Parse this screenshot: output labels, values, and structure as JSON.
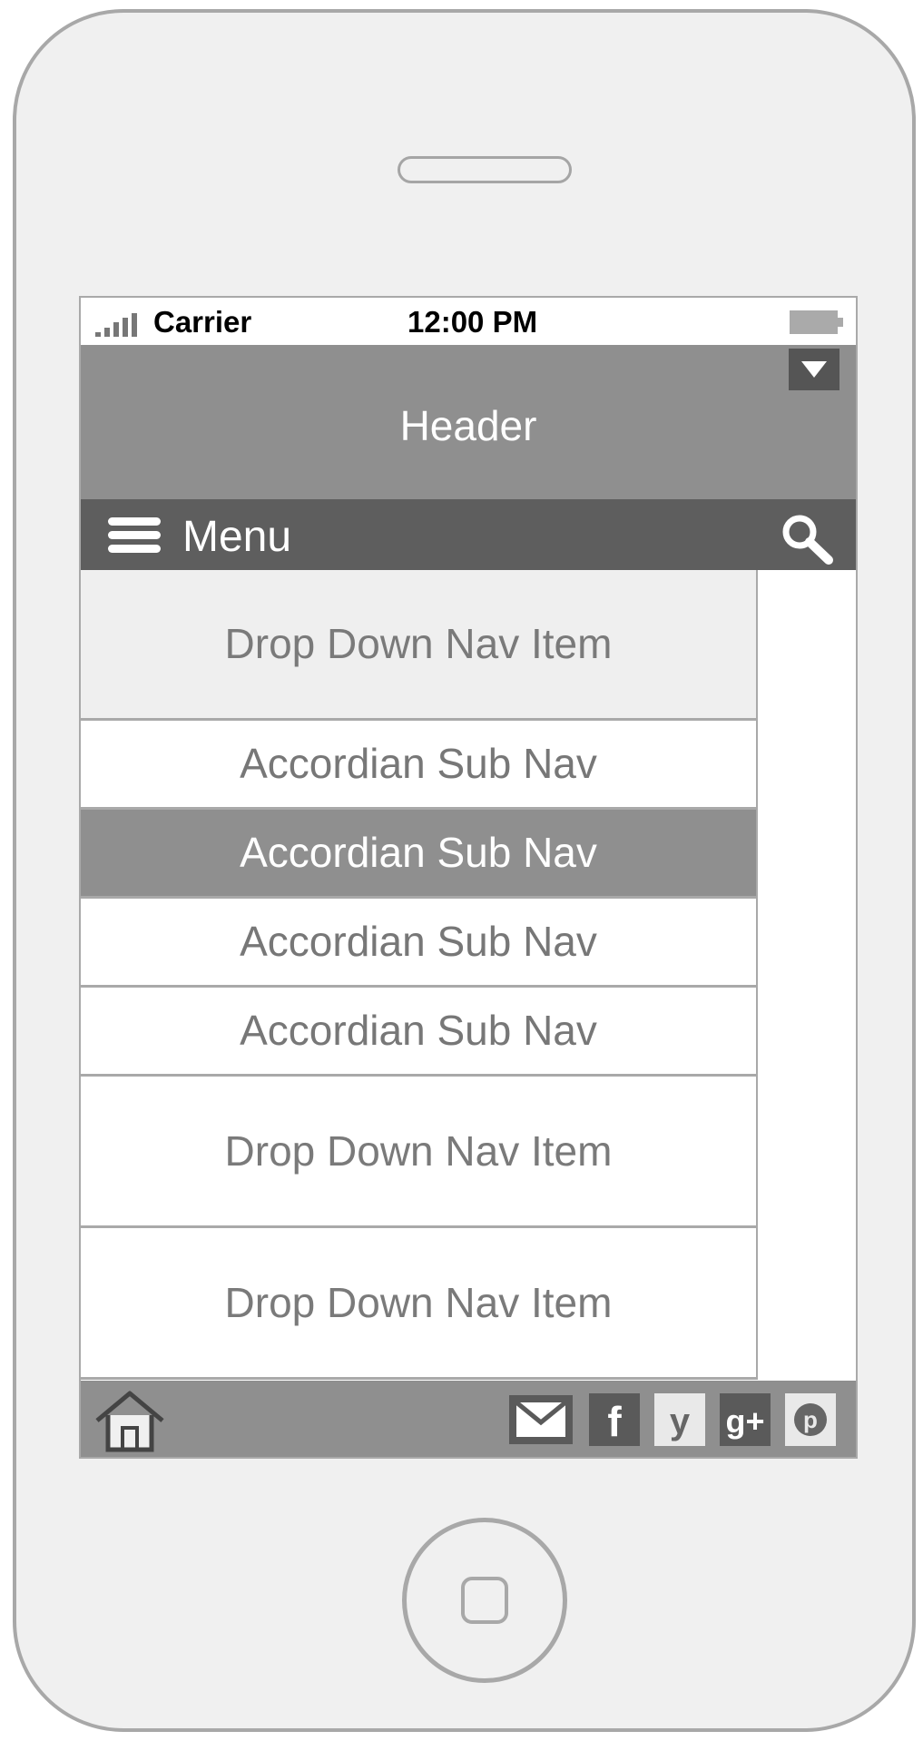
{
  "status_bar": {
    "carrier": "Carrier",
    "time": "12:00 PM"
  },
  "header": {
    "title": "Header"
  },
  "menu_bar": {
    "label": "Menu"
  },
  "nav": {
    "items": [
      {
        "label": "Drop Down Nav Item"
      },
      {
        "label": "Accordian Sub Nav"
      },
      {
        "label": "Accordian Sub Nav",
        "active": true
      },
      {
        "label": "Accordian Sub Nav"
      },
      {
        "label": "Accordian Sub Nav"
      },
      {
        "label": "Drop Down Nav Item"
      },
      {
        "label": "Drop Down Nav Item"
      }
    ]
  },
  "footer": {
    "icons": [
      "home-icon",
      "mail-icon",
      "facebook-icon",
      "twitter-icon",
      "google-plus-icon",
      "pinterest-icon"
    ],
    "social_glyphs": {
      "facebook": "f",
      "twitter": "y",
      "google_plus": "g+",
      "pinterest": "p"
    }
  },
  "colors": {
    "header_bg": "#8f8f8f",
    "menu_bg": "#5e5e5e",
    "active_item_bg": "#8f8f8f",
    "nav_text": "#7a7a7a"
  }
}
